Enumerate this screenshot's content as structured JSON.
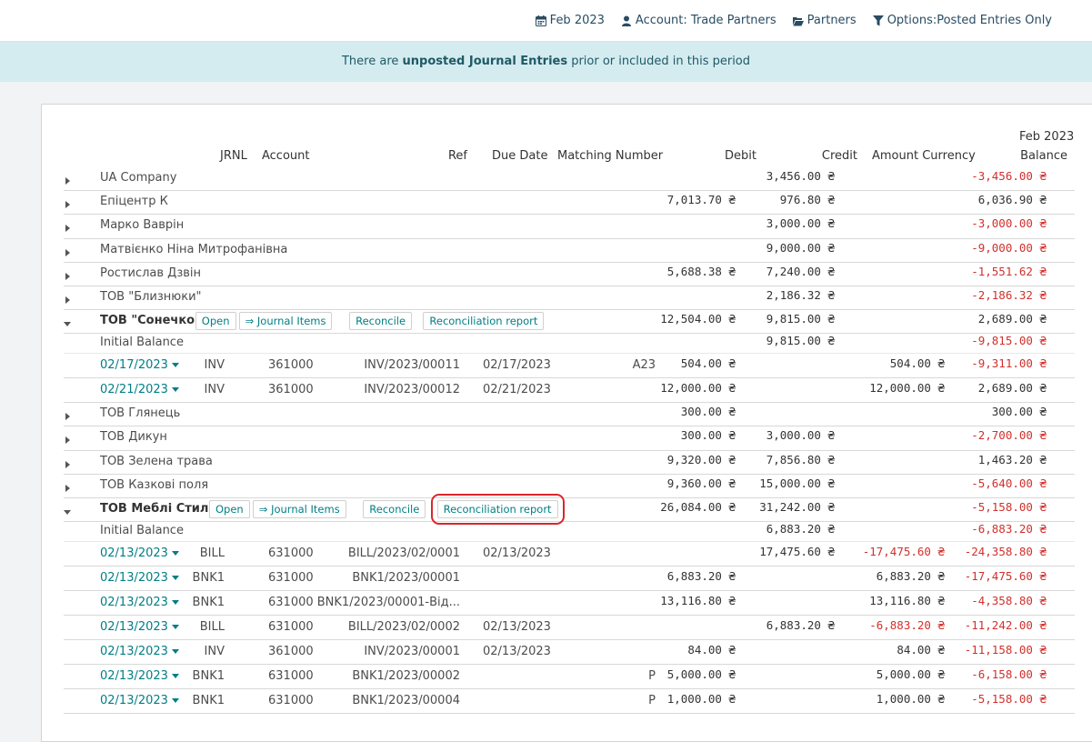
{
  "filters": {
    "date": "Feb 2023",
    "account": "Account: Trade Partners",
    "partners": "Partners",
    "options": "Options:Posted Entries Only"
  },
  "alert": {
    "pre": "There are ",
    "bold": "unposted Journal Entries",
    "post": " prior or included in this period"
  },
  "columns": {
    "period": "Feb 2023",
    "jrnl": "JRNL",
    "account": "Account",
    "ref": "Ref",
    "due_date": "Due Date",
    "matching": "Matching Number",
    "debit": "Debit",
    "credit": "Credit",
    "amount_currency": "Amount Currency",
    "balance": "Balance"
  },
  "buttons": {
    "open": "Open",
    "journal_items": "⇒ Journal Items",
    "reconcile": "Reconcile",
    "reconciliation_report": "Reconciliation report"
  },
  "rows": [
    {
      "kind": "partner",
      "name": "UA Company",
      "debit": "",
      "credit": "3,456.00 ₴",
      "balance": "-3,456.00 ₴",
      "negative": true
    },
    {
      "kind": "partner",
      "name": "Епіцентр К",
      "debit": "7,013.70 ₴",
      "credit": "976.80 ₴",
      "balance": "6,036.90 ₴",
      "negative": false
    },
    {
      "kind": "partner",
      "name": "Марко Ваврін",
      "debit": "",
      "credit": "3,000.00 ₴",
      "balance": "-3,000.00 ₴",
      "negative": true
    },
    {
      "kind": "partner",
      "name": "Матвієнко Ніна Митрофанівна",
      "debit": "",
      "credit": "9,000.00 ₴",
      "balance": "-9,000.00 ₴",
      "negative": true
    },
    {
      "kind": "partner",
      "name": "Ростислав Дзвін",
      "debit": "5,688.38 ₴",
      "credit": "7,240.00 ₴",
      "balance": "-1,551.62 ₴",
      "negative": true
    },
    {
      "kind": "partner",
      "name": "ТОВ \"Близнюки\"",
      "debit": "",
      "credit": "2,186.32 ₴",
      "balance": "-2,186.32 ₴",
      "negative": true
    },
    {
      "kind": "expanded",
      "name": "ТОВ \"Сонечко\"",
      "debit": "12,504.00 ₴",
      "credit": "9,815.00 ₴",
      "balance": "2,689.00 ₴",
      "negative": false
    },
    {
      "kind": "initial",
      "name": "Initial Balance",
      "debit": "",
      "credit": "9,815.00 ₴",
      "balance": "-9,815.00 ₴",
      "negative": true
    },
    {
      "kind": "line",
      "date": "02/17/2023",
      "jrnl": "INV",
      "account": "361000",
      "ref": "INV/2023/00011",
      "due": "02/17/2023",
      "matching": "A23",
      "debit": "504.00 ₴",
      "credit": "",
      "amount_currency": "504.00 ₴",
      "amount_negative": false,
      "balance": "-9,311.00 ₴",
      "negative": true
    },
    {
      "kind": "line",
      "date": "02/21/2023",
      "jrnl": "INV",
      "account": "361000",
      "ref": "INV/2023/00012",
      "due": "02/21/2023",
      "matching": "",
      "debit": "12,000.00 ₴",
      "credit": "",
      "amount_currency": "12,000.00 ₴",
      "amount_negative": false,
      "balance": "2,689.00 ₴",
      "negative": false
    },
    {
      "kind": "partner",
      "name": "ТОВ Глянець",
      "debit": "300.00 ₴",
      "credit": "",
      "balance": "300.00 ₴",
      "negative": false
    },
    {
      "kind": "partner",
      "name": "ТОВ Дикун",
      "debit": "300.00 ₴",
      "credit": "3,000.00 ₴",
      "balance": "-2,700.00 ₴",
      "negative": true
    },
    {
      "kind": "partner",
      "name": "ТОВ Зелена трава",
      "debit": "9,320.00 ₴",
      "credit": "7,856.80 ₴",
      "balance": "1,463.20 ₴",
      "negative": false
    },
    {
      "kind": "partner",
      "name": "ТОВ Казкові поля",
      "debit": "9,360.00 ₴",
      "credit": "15,000.00 ₴",
      "balance": "-5,640.00 ₴",
      "negative": true
    },
    {
      "kind": "expanded",
      "name": "ТОВ Меблі Стиль",
      "debit": "26,084.00 ₴",
      "credit": "31,242.00 ₴",
      "balance": "-5,158.00 ₴",
      "negative": true,
      "highlight": true
    },
    {
      "kind": "initial",
      "name": "Initial Balance",
      "debit": "",
      "credit": "6,883.20 ₴",
      "balance": "-6,883.20 ₴",
      "negative": true
    },
    {
      "kind": "line",
      "date": "02/13/2023",
      "jrnl": "BILL",
      "account": "631000",
      "ref": "BILL/2023/02/0001",
      "due": "02/13/2023",
      "matching": "",
      "debit": "",
      "credit": "17,475.60 ₴",
      "amount_currency": "-17,475.60 ₴",
      "amount_negative": true,
      "balance": "-24,358.80 ₴",
      "negative": true
    },
    {
      "kind": "line",
      "date": "02/13/2023",
      "jrnl": "BNK1",
      "account": "631000",
      "ref": "BNK1/2023/00001",
      "due": "",
      "matching": "",
      "debit": "6,883.20 ₴",
      "credit": "",
      "amount_currency": "6,883.20 ₴",
      "amount_negative": false,
      "balance": "-17,475.60 ₴",
      "negative": true
    },
    {
      "kind": "line",
      "date": "02/13/2023",
      "jrnl": "BNK1",
      "account": "631000",
      "ref": "BNK1/2023/00001-Від...",
      "due": "",
      "matching": "",
      "debit": "13,116.80 ₴",
      "credit": "",
      "amount_currency": "13,116.80 ₴",
      "amount_negative": false,
      "balance": "-4,358.80 ₴",
      "negative": true
    },
    {
      "kind": "line",
      "date": "02/13/2023",
      "jrnl": "BILL",
      "account": "631000",
      "ref": "BILL/2023/02/0002",
      "due": "02/13/2023",
      "matching": "",
      "debit": "",
      "credit": "6,883.20 ₴",
      "amount_currency": "-6,883.20 ₴",
      "amount_negative": true,
      "balance": "-11,242.00 ₴",
      "negative": true
    },
    {
      "kind": "line",
      "date": "02/13/2023",
      "jrnl": "INV",
      "account": "361000",
      "ref": "INV/2023/00001",
      "due": "02/13/2023",
      "matching": "",
      "debit": "84.00 ₴",
      "credit": "",
      "amount_currency": "84.00 ₴",
      "amount_negative": false,
      "balance": "-11,158.00 ₴",
      "negative": true
    },
    {
      "kind": "line",
      "date": "02/13/2023",
      "jrnl": "BNK1",
      "account": "631000",
      "ref": "BNK1/2023/00002",
      "due": "",
      "matching": "P",
      "debit": "5,000.00 ₴",
      "credit": "",
      "amount_currency": "5,000.00 ₴",
      "amount_negative": false,
      "balance": "-6,158.00 ₴",
      "negative": true
    },
    {
      "kind": "line",
      "date": "02/13/2023",
      "jrnl": "BNK1",
      "account": "631000",
      "ref": "BNK1/2023/00004",
      "due": "",
      "matching": "P",
      "debit": "1,000.00 ₴",
      "credit": "",
      "amount_currency": "1,000.00 ₴",
      "amount_negative": false,
      "balance": "-5,158.00 ₴",
      "negative": true
    }
  ]
}
